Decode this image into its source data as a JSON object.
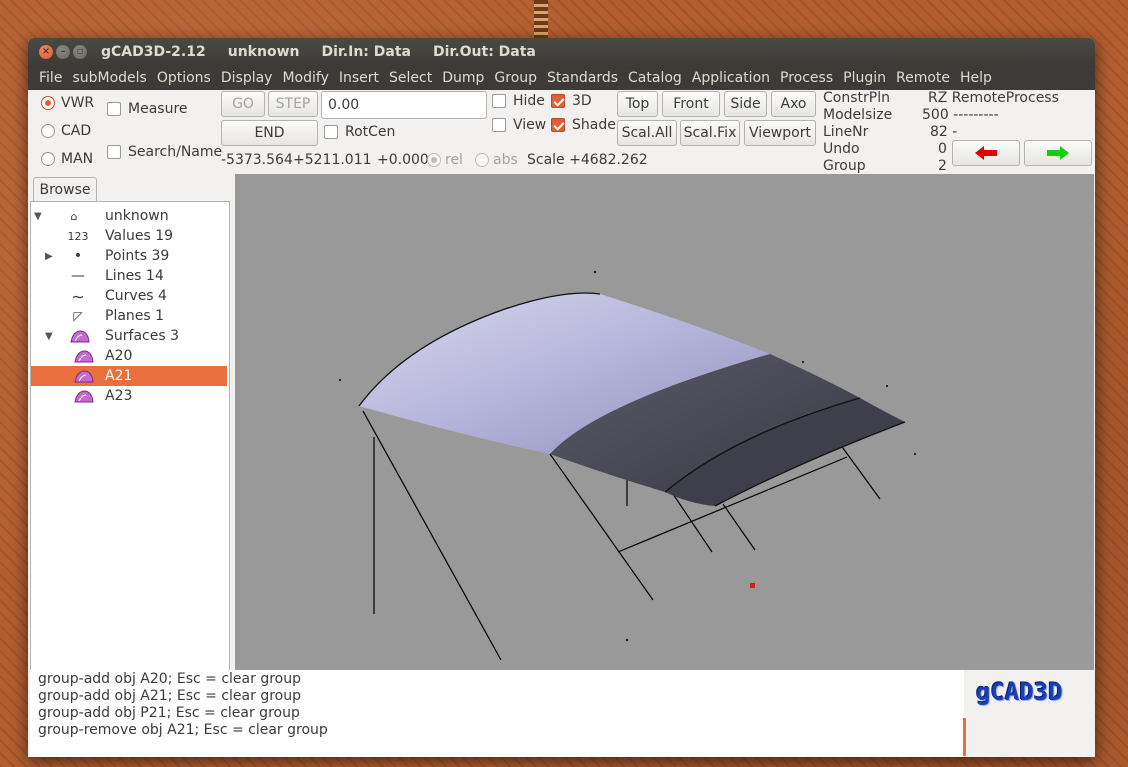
{
  "window": {
    "app_title": "gCAD3D-2.12",
    "model": "unknown",
    "dir_in": "Dir.In: Data",
    "dir_out": "Dir.Out: Data"
  },
  "menu": [
    "File",
    "subModels",
    "Options",
    "Display",
    "Modify",
    "Insert",
    "Select",
    "Dump",
    "Group",
    "Standards",
    "Catalog",
    "Application",
    "Process",
    "Plugin",
    "Remote",
    "Help"
  ],
  "mode_radios": [
    {
      "label": "VWR",
      "selected": true
    },
    {
      "label": "CAD",
      "selected": false
    },
    {
      "label": "MAN",
      "selected": false
    }
  ],
  "checks": {
    "measure": {
      "label": "Measure",
      "checked": false
    },
    "search": {
      "label": "Search/Name",
      "checked": false
    },
    "rotcen": {
      "label": "RotCen",
      "checked": false
    },
    "hide": {
      "label": "Hide",
      "checked": false
    },
    "view": {
      "label": "View",
      "checked": false
    },
    "three_d": {
      "label": "3D",
      "checked": true
    },
    "shade": {
      "label": "Shade",
      "checked": true
    }
  },
  "buttons": {
    "go": "GO",
    "step": "STEP",
    "end": "END",
    "top": "Top",
    "front": "Front",
    "side": "Side",
    "axo": "Axo",
    "scal_all": "Scal.All",
    "scal_fix": "Scal.Fix",
    "viewport": "Viewport"
  },
  "value_entry": "0.00",
  "coords": {
    "x": "-5373.564",
    "y": "+5211.011",
    "z": "+0.000",
    "rel": "rel",
    "abs": "abs",
    "scale": "Scale  +4682.262"
  },
  "info": {
    "constrpln_label": "ConstrPln",
    "constrpln_value": "RZ RemoteProcess",
    "modelsize_label": "Modelsize",
    "modelsize_value": "500 ---------",
    "linenr_label": "LineNr",
    "linenr_value": "82 -",
    "undo_label": "Undo",
    "undo_value": "0",
    "group_label": "Group",
    "group_value": "2"
  },
  "browse": {
    "tab": "Browse",
    "items": [
      {
        "label": "unknown",
        "icon": "model-icon",
        "glyph": "⌂"
      },
      {
        "label": "Values 19",
        "icon": "values-icon",
        "glyph": "123"
      },
      {
        "label": "Points 39",
        "icon": "point-icon",
        "glyph": "•"
      },
      {
        "label": "Lines 14",
        "icon": "line-icon",
        "glyph": "—"
      },
      {
        "label": "Curves 4",
        "icon": "curve-icon",
        "glyph": "∼"
      },
      {
        "label": "Planes 1",
        "icon": "plane-icon",
        "glyph": "◸"
      },
      {
        "label": "Surfaces 3",
        "icon": "surface-icon",
        "glyph": ""
      },
      {
        "label": "A20",
        "icon": "surface-icon",
        "glyph": ""
      },
      {
        "label": "A21",
        "icon": "surface-icon",
        "glyph": ""
      },
      {
        "label": "A23",
        "icon": "surface-icon",
        "glyph": ""
      }
    ],
    "selected": "A21"
  },
  "console_lines": [
    "group-add  obj A20; Esc = clear group",
    "group-add  obj A21; Esc = clear group",
    "group-add  obj P21; Esc = clear group",
    "group-remove  obj A21; Esc = clear group"
  ],
  "logo": "gCAD3D",
  "colors": {
    "accent": "#e96f3f",
    "viewport_bg": "#999999",
    "surface_light": "#b9b8dc",
    "surface_dark": "#4a4a55",
    "arrow_back": "#e00000",
    "arrow_fwd": "#10d010"
  }
}
